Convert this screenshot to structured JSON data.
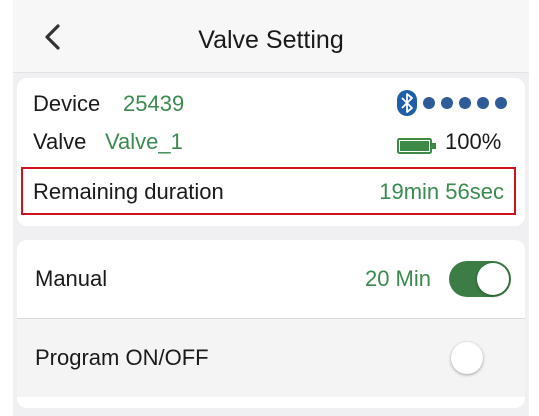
{
  "header": {
    "title": "Valve Setting",
    "back_icon": "chevron-left-icon"
  },
  "device_info": {
    "device_label": "Device",
    "device_value": "25439",
    "valve_label": "Valve",
    "valve_value": "Valve_1",
    "bluetooth_icon": "bluetooth-icon",
    "signal_strength_dots": 5,
    "battery_icon": "battery-icon",
    "battery_level": "100%",
    "remaining_label": "Remaining duration",
    "remaining_value": "19min 56sec"
  },
  "settings": {
    "manual_label": "Manual",
    "manual_value": "20 Min",
    "manual_enabled": true,
    "program_label": "Program ON/OFF",
    "program_enabled": false
  },
  "colors": {
    "accent_green": "#3b8a4f",
    "toggle_on": "#3c7d45",
    "highlight_border": "#d0121e",
    "bluetooth_blue": "#1f5fa8",
    "signal_dot": "#2e5c99",
    "battery_fill": "#3c8a46"
  }
}
